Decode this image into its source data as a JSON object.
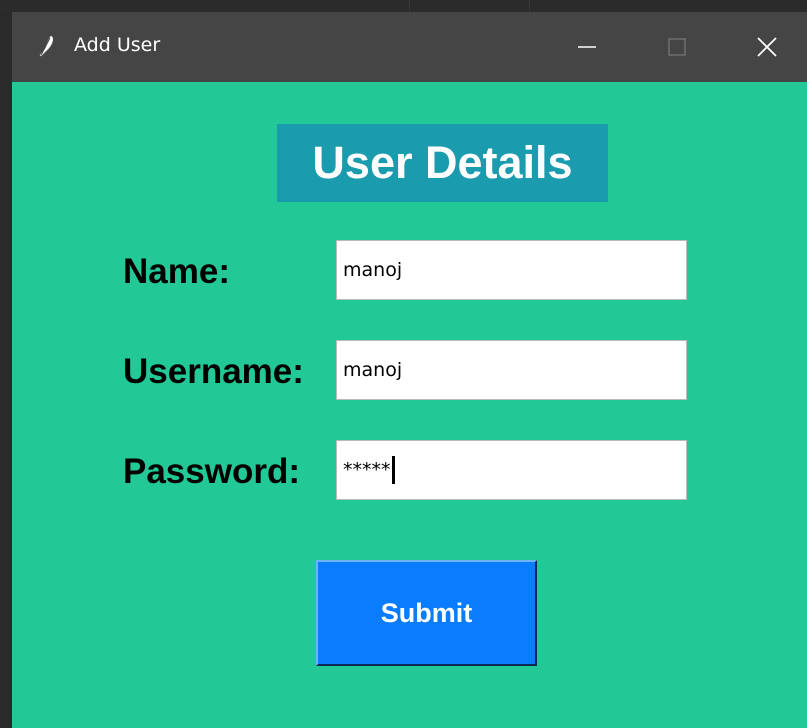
{
  "window": {
    "title": "Add User",
    "controls": {
      "minimize": "minimize-icon",
      "maximize": "maximize-icon",
      "close": "close-icon"
    }
  },
  "form": {
    "heading": "User Details",
    "name_label": "Name:",
    "name_value": "manoj",
    "username_label": "Username:",
    "username_value": "manoj",
    "password_label": "Password:",
    "password_value": "*****",
    "submit_label": "Submit"
  },
  "colors": {
    "background": "#22c896",
    "heading_bg": "#1b9bae",
    "submit_bg": "#0a7dff",
    "titlebar": "#454545"
  }
}
